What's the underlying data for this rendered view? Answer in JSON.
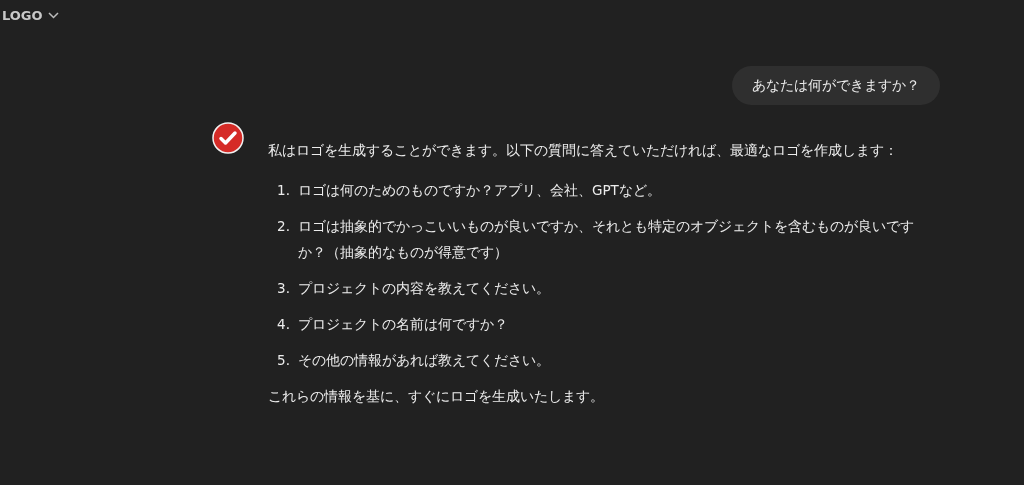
{
  "header": {
    "title": "LOGO"
  },
  "user_message": {
    "text": "あなたは何ができますか？"
  },
  "assistant_message": {
    "intro": "私はロゴを生成することができます。以下の質問に答えていただければ、最適なロゴを作成します：",
    "items": [
      {
        "number": "1.",
        "text": "ロゴは何のためのものですか？アプリ、会社、GPTなど。"
      },
      {
        "number": "2.",
        "text": "ロゴは抽象的でかっこいいものが良いですか、それとも特定のオブジェクトを含むものが良いですか？（抽象的なものが得意です）"
      },
      {
        "number": "3.",
        "text": "プロジェクトの内容を教えてください。"
      },
      {
        "number": "4.",
        "text": "プロジェクトの名前は何ですか？"
      },
      {
        "number": "5.",
        "text": "その他の情報があれば教えてください。"
      }
    ],
    "outro": "これらの情報を基に、すぐにロゴを生成いたします。"
  }
}
